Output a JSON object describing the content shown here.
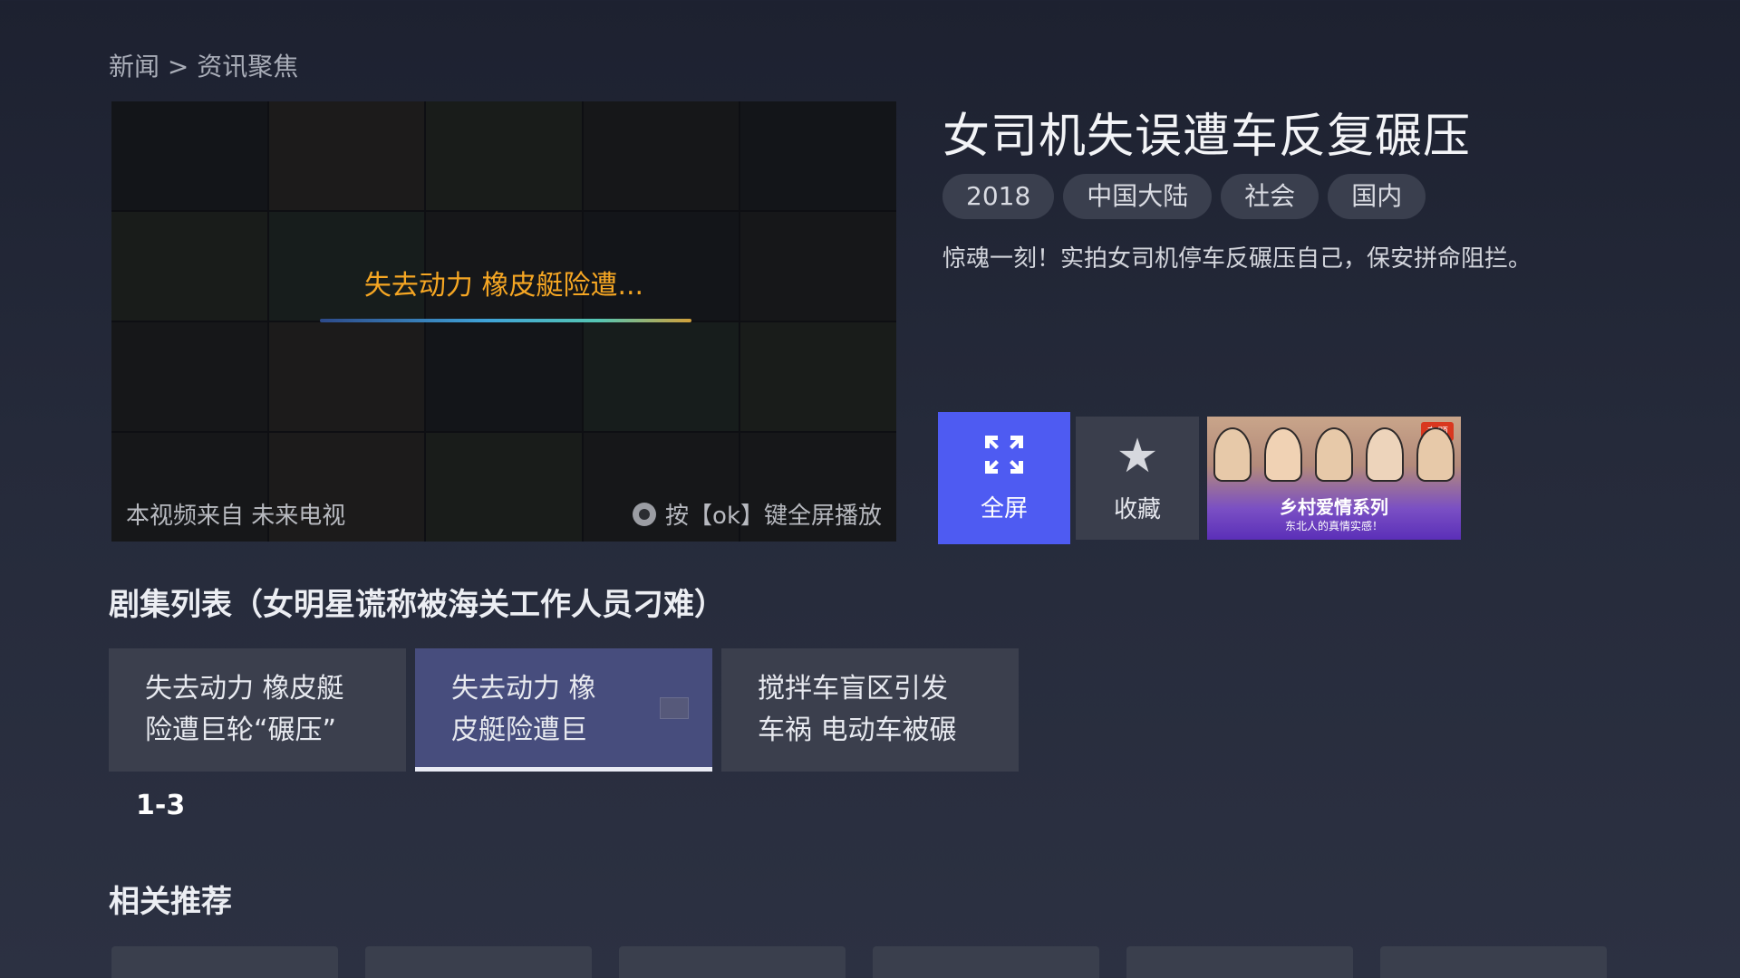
{
  "breadcrumb": "新闻 > 资讯聚焦",
  "player": {
    "loading_title": "失去动力 橡皮艇险遭...",
    "source": "本视频来自 未来电视",
    "hint": "按【ok】键全屏播放"
  },
  "video": {
    "title": "女司机失误遭车反复碾压",
    "tags": [
      "2018",
      "中国大陆",
      "社会",
      "国内"
    ],
    "description": "惊魂一刻！实拍女司机停车反碾压自己，保安拼命阻拦。"
  },
  "actions": {
    "fullscreen_label": "全屏",
    "favorite_label": "收藏"
  },
  "promo": {
    "badge": "专题",
    "title": "乡村爱情系列",
    "subtitle": "东北人的真情实感！"
  },
  "episode_section": {
    "title": "剧集列表（女明星谎称被海关工作人员刁难）",
    "episodes": [
      {
        "line1": "失去动力 橡皮艇",
        "line2": "险遭巨轮“碾压”"
      },
      {
        "line1": "失去动力 橡",
        "line2": "皮艇险遭巨"
      },
      {
        "line1": "搅拌车盲区引发",
        "line2": "车祸 电动车被碾"
      }
    ],
    "range": "1-3"
  },
  "recommend": {
    "title": "相关推荐"
  },
  "colors": {
    "accent": "#4e5bf2",
    "loading_text": "#f5a623",
    "active_episode": "#474d7d"
  }
}
